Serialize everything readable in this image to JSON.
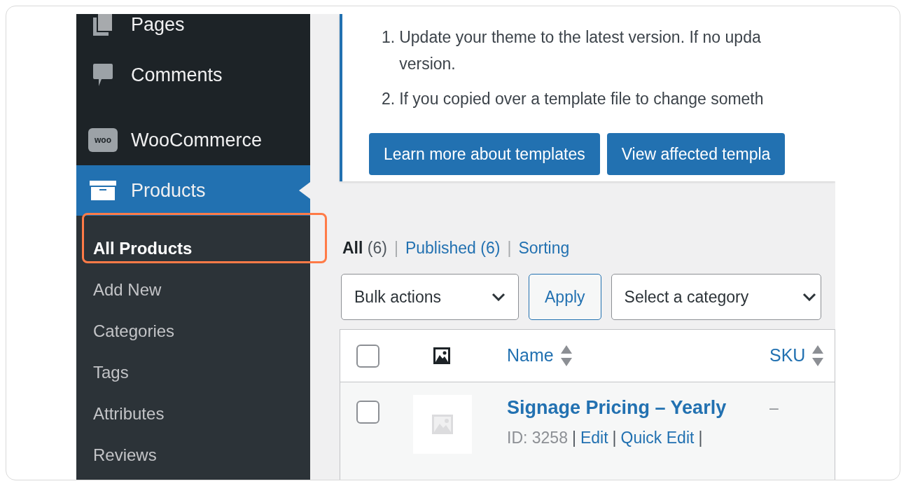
{
  "sidebar": {
    "menu": [
      {
        "label": "Pages",
        "kind": "pages",
        "selected": false
      },
      {
        "label": "Comments",
        "kind": "comments",
        "selected": false
      },
      {
        "label": "WooCommerce",
        "kind": "woo",
        "logo_text": "woo",
        "selected": false
      },
      {
        "label": "Products",
        "kind": "products",
        "selected": true
      }
    ],
    "submenu": [
      {
        "label": "All Products",
        "selected": true,
        "highlighted": true
      },
      {
        "label": "Add New",
        "selected": false,
        "highlighted": false
      },
      {
        "label": "Categories",
        "selected": false,
        "highlighted": false
      },
      {
        "label": "Tags",
        "selected": false,
        "highlighted": false
      },
      {
        "label": "Attributes",
        "selected": false,
        "highlighted": false
      },
      {
        "label": "Reviews",
        "selected": false,
        "highlighted": false
      }
    ]
  },
  "notice": {
    "items": [
      {
        "number": "1.",
        "lines": [
          "Update your theme to the latest version. If no upda",
          "version."
        ]
      },
      {
        "number": "2.",
        "lines": [
          "If you copied over a template file to change someth"
        ]
      }
    ],
    "buttons": [
      "Learn more about templates",
      "View affected templa"
    ]
  },
  "views": [
    {
      "label": "All",
      "count": "(6)",
      "selected": true
    },
    {
      "label": "Published",
      "count": "(6)",
      "selected": false
    },
    {
      "label": "Sorting",
      "selected": false
    }
  ],
  "view_separator": "|",
  "bulk_actions": "Bulk actions",
  "apply": "Apply",
  "category": "Select a category",
  "table": {
    "columns": [
      {
        "kind": "checkbox",
        "checked": false
      },
      {
        "kind": "image"
      },
      {
        "kind": "sortable",
        "label": "Name"
      },
      {
        "kind": "sortable",
        "label": "SKU"
      }
    ],
    "rows": [
      {
        "checked": false,
        "name": "Signage Pricing – Yearly",
        "sku": "–",
        "id": "ID: 3258",
        "separator": "|",
        "actions": [
          "Edit",
          "Quick Edit"
        ]
      }
    ]
  }
}
